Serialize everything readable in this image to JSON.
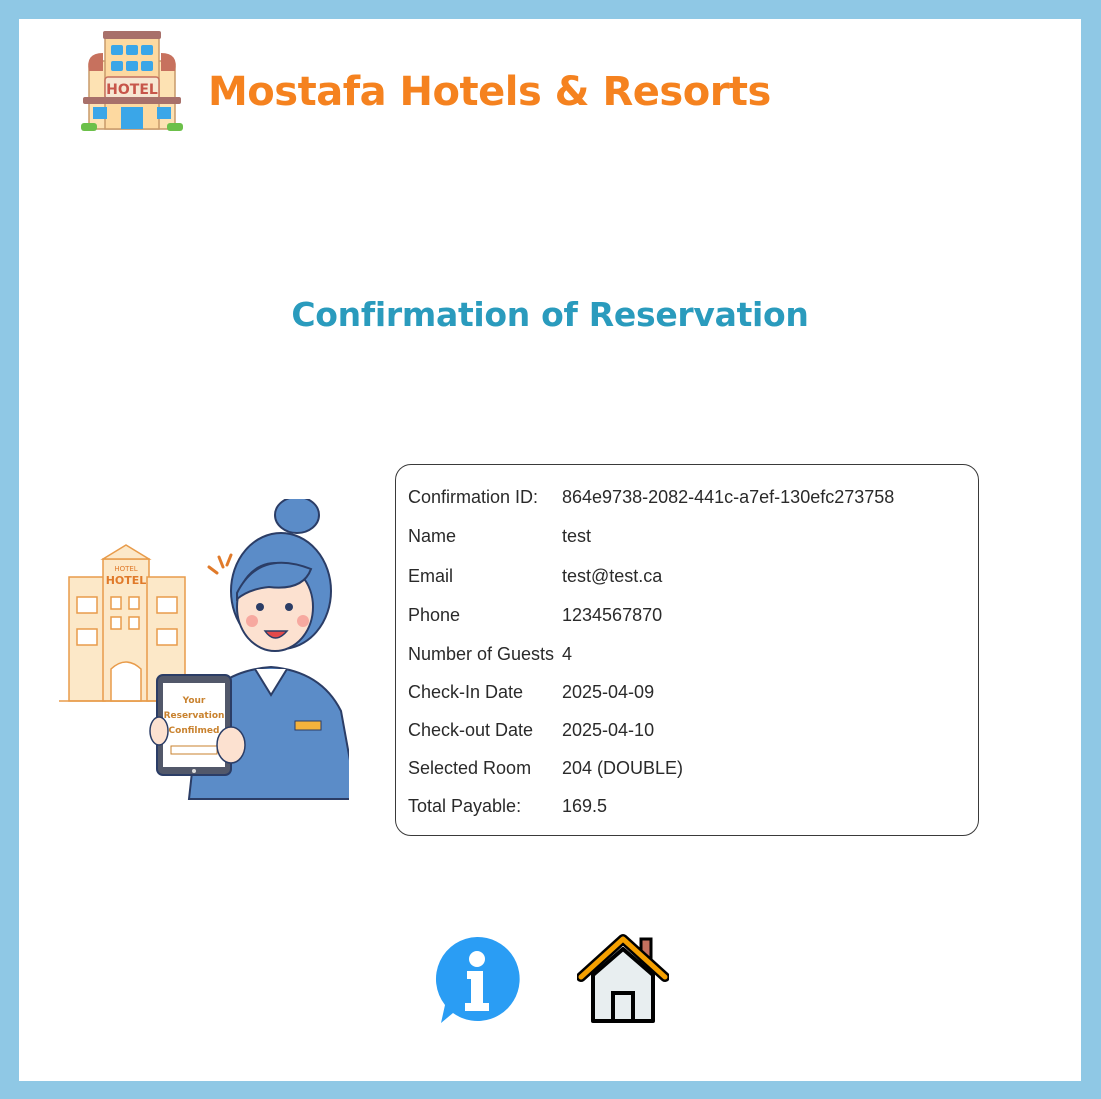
{
  "brand": {
    "name": "Mostafa Hotels & Resorts",
    "logo_text": "HOTEL",
    "color": "#f5821f"
  },
  "page": {
    "title": "Confirmation of Reservation",
    "title_color": "#2a9bbd"
  },
  "illustration": {
    "building_sign": "HOTEL",
    "building_sign_small": "HOTEL",
    "tablet_line1": "Your",
    "tablet_line2": "Reservation",
    "tablet_line3": "Confilmed"
  },
  "reservation": [
    {
      "label": "Confirmation ID:",
      "value": "864e9738-2082-441c-a7ef-130efc273758"
    },
    {
      "label": "Name",
      "value": "test"
    },
    {
      "label": "Email",
      "value": "test@test.ca"
    },
    {
      "label": "Phone",
      "value": "1234567870"
    },
    {
      "label": "Number of Guests",
      "value": "4"
    },
    {
      "label": "Check-In Date",
      "value": "2025-04-09"
    },
    {
      "label": "Check-out Date",
      "value": "2025-04-10"
    },
    {
      "label": "Selected Room",
      "value": "204 (DOUBLE)"
    },
    {
      "label": "Total Payable:",
      "value": "169.5"
    }
  ],
  "actions": [
    {
      "icon": "info-icon",
      "color": "#2a9df4"
    },
    {
      "icon": "home-icon",
      "color": "#f5a000"
    }
  ]
}
